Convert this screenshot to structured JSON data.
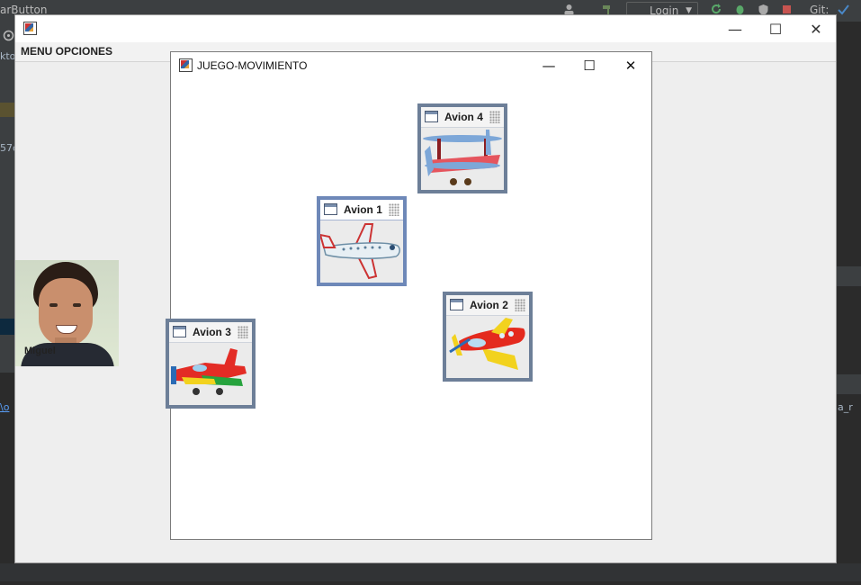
{
  "ide": {
    "title_fragment": "arButton",
    "login_label": "Login",
    "git_label": "Git:",
    "snippets": [
      "kto",
      "57d",
      "\\o",
      "a_r"
    ]
  },
  "main_window": {
    "menu": {
      "label": "MENU OPCIONES"
    },
    "controls": {
      "minimize": "—",
      "maximize": "☐",
      "close": "✕"
    }
  },
  "photo": {
    "label": "Miguel"
  },
  "game_window": {
    "title": "JUEGO-MOVIMIENTO",
    "controls": {
      "minimize": "—",
      "maximize": "☐",
      "close": "✕"
    },
    "planes": [
      {
        "label": "Avion 4",
        "style": "biplane"
      },
      {
        "label": "Avion 1",
        "style": "jet"
      },
      {
        "label": "Avion 2",
        "style": "yellow-red"
      },
      {
        "label": "Avion 3",
        "style": "toy"
      }
    ]
  },
  "colors": {
    "ide_dark": "#2b2b2b",
    "window_bg": "#eeeeee",
    "frame_border": "#6d7f98",
    "frame_active": "#6e88b8"
  }
}
